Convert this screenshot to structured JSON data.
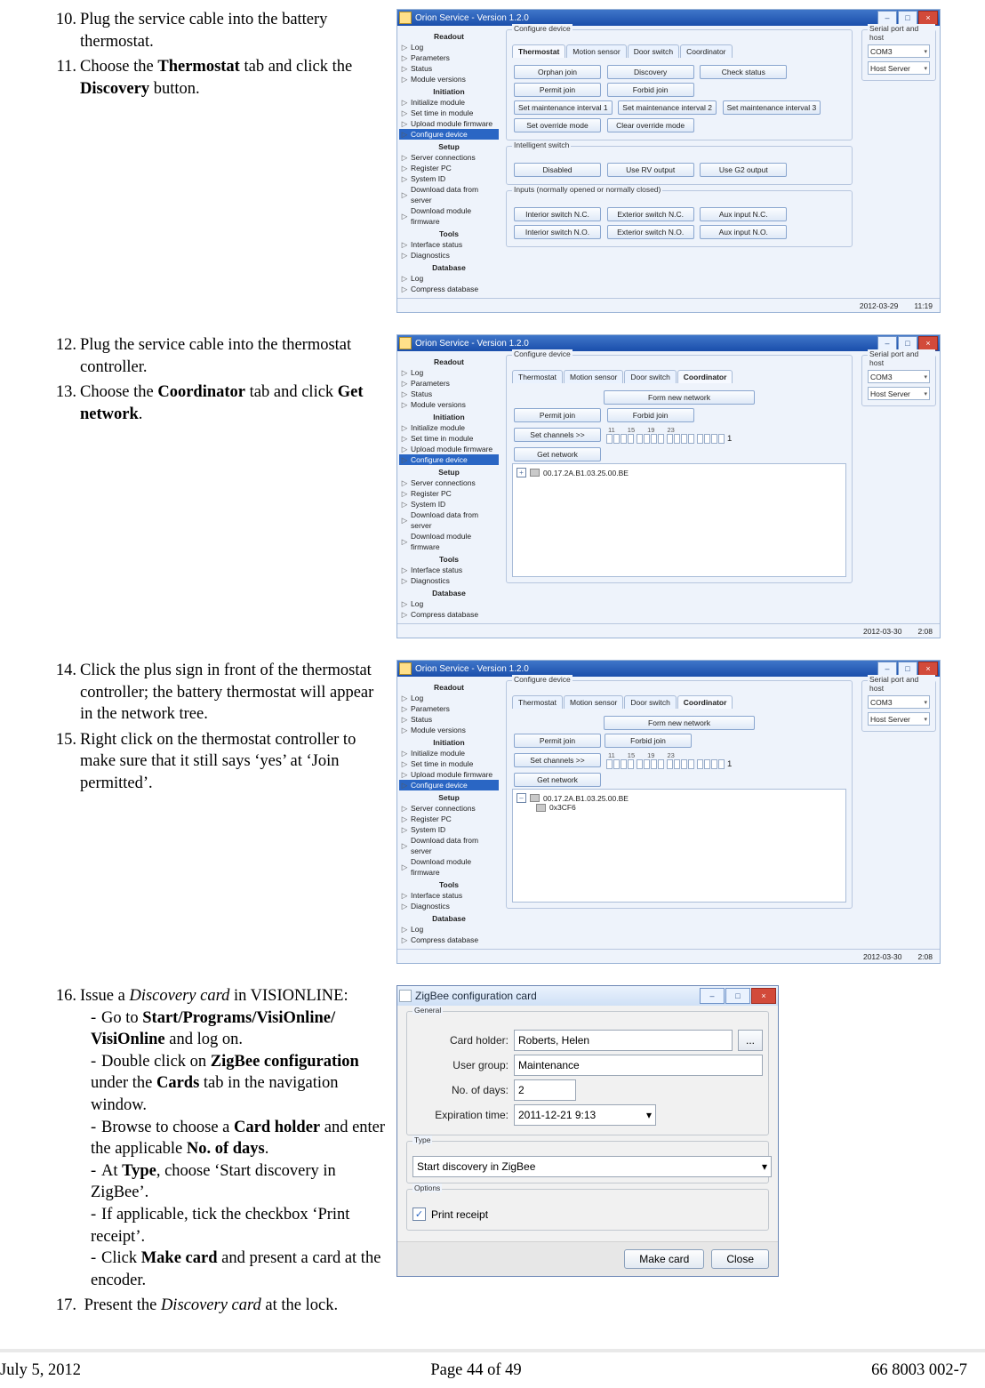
{
  "footer": {
    "date": "July 5, 2012",
    "page": "Page 44 of 49",
    "doc": "66 8003 002-7"
  },
  "steps": {
    "s10": "Plug the service cable into the battery thermostat.",
    "s11_a": "Choose the ",
    "s11_b": "Thermostat",
    "s11_c": " tab and click the ",
    "s11_d": "Discovery",
    "s11_e": " button.",
    "s12": "Plug the service cable into the thermostat controller.",
    "s13_a": "Choose the ",
    "s13_b": "Coordinator",
    "s13_c": " tab and click ",
    "s13_d": "Get network",
    "s13_e": ".",
    "s14": "Click the plus sign in front of the thermostat controller; the battery thermostat will appear in the network tree.",
    "s15": "Right click on the thermostat controller to make sure that it still says ‘yes’ at ‘Join permitted’.",
    "s16_a": "Issue a ",
    "s16_b": "Discovery card",
    "s16_c": " in VISIONLINE:",
    "s16_1a": "Go to ",
    "s16_1b": "Start/Programs/VisiOnline/ VisiOnline",
    "s16_1c": " and log on.",
    "s16_2a": "Double click on ",
    "s16_2b": "ZigBee configuration",
    "s16_2c": " under the ",
    "s16_2d": "Cards",
    "s16_2e": " tab in the navigation window.",
    "s16_3a": "Browse to choose a ",
    "s16_3b": "Card holder",
    "s16_3c": " and enter the applicable ",
    "s16_3d": "No. of days",
    "s16_3e": ".",
    "s16_4a": "At ",
    "s16_4b": "Type",
    "s16_4c": ", choose ‘Start discovery  in ZigBee’.",
    "s16_5": "If applicable, tick the checkbox ‘Print receipt’.",
    "s16_6a": "Click ",
    "s16_6b": "Make card",
    "s16_6c": " and present a card at the encoder.",
    "s17_a": "Present the ",
    "s17_b": "Discovery card",
    "s17_c": " at the lock."
  },
  "app": {
    "title1": "Orion Service - Version 1.2.0",
    "sidebar": {
      "heads": [
        "Readout",
        "Initiation",
        "Setup",
        "Tools",
        "Database"
      ],
      "readout": [
        "Log",
        "Parameters",
        "Status",
        "Module versions"
      ],
      "init": [
        "Initialize module",
        "Set time in module",
        "Upload module firmware",
        "Configure device"
      ],
      "setup": [
        "Server connections",
        "Register PC",
        "System ID",
        "Download data from server",
        "Download module firmware"
      ],
      "tools": [
        "Interface status",
        "Diagnostics"
      ],
      "db": [
        "Log",
        "Compress database"
      ]
    },
    "tabs": [
      "Thermostat",
      "Motion sensor",
      "Door switch",
      "Coordinator"
    ],
    "cfg": "Configure device",
    "is": "Intelligent switch",
    "inp": "Inputs (normally opened or normally closed)",
    "btns": {
      "orphan": "Orphan join",
      "disc": "Discovery",
      "chk": "Check status",
      "pjoin": "Permit join",
      "fjoin": "Forbid join",
      "sm1": "Set maintenance interval 1",
      "sm2": "Set maintenance interval 2",
      "sm3": "Set maintenance interval 3",
      "sov": "Set override mode",
      "cov": "Clear override mode",
      "dis": "Disabled",
      "rv": "Use RV output",
      "g2": "Use G2 output",
      "isnc": "Interior switch N.C.",
      "esnc": "Exterior switch N.C.",
      "ainc": "Aux input N.C.",
      "isno": "Interior switch N.O.",
      "esno": "Exterior switch N.O.",
      "aino": "Aux input N.O.",
      "formnet": "Form new network",
      "setch": "Set channels  >>",
      "getnet": "Get network"
    },
    "chan": [
      "11",
      "15",
      "19",
      "23"
    ],
    "chan_end": "1",
    "mac": "00.17.2A.B1.03.25.00.BE",
    "child": "0x3CF6",
    "sp": {
      "title": "Serial port and host",
      "com": "COM3",
      "host": "Host Server"
    },
    "status": [
      {
        "d": "2012-03-29",
        "t": "11:19"
      },
      {
        "d": "2012-03-30",
        "t": "2:08"
      },
      {
        "d": "2012-03-30",
        "t": "2:08"
      }
    ]
  },
  "zb": {
    "title": "ZigBee configuration card",
    "general": "General",
    "type": "Type",
    "options": "Options",
    "card_holder_l": "Card holder:",
    "card_holder_v": "Roberts, Helen",
    "user_group_l": "User group:",
    "user_group_v": "Maintenance",
    "days_l": "No. of days:",
    "days_v": "2",
    "exp_l": "Expiration time:",
    "exp_v": "2011-12-21 9:13",
    "type_v": "Start discovery in ZigBee",
    "print": "Print receipt",
    "make": "Make card",
    "close": "Close"
  }
}
